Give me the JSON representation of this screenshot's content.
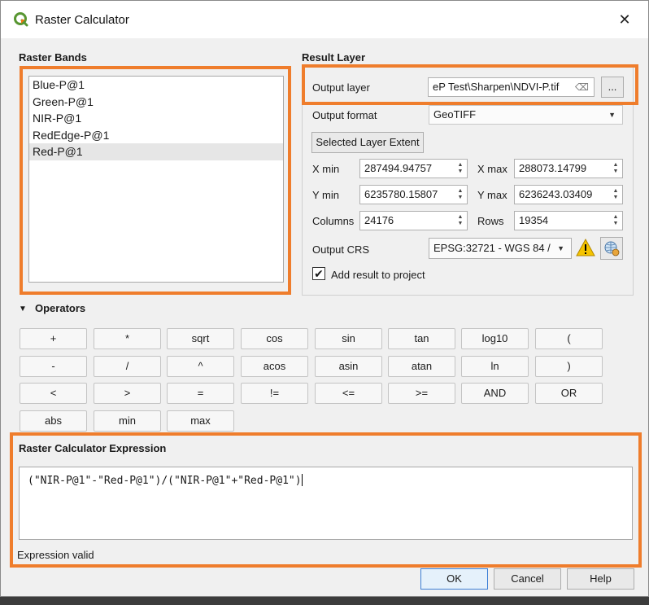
{
  "window": {
    "title": "Raster Calculator",
    "close_glyph": "✕"
  },
  "raster_bands": {
    "title": "Raster Bands",
    "items": [
      "Blue-P@1",
      "Green-P@1",
      "NIR-P@1",
      "RedEdge-P@1",
      "Red-P@1"
    ],
    "selected_index": 4
  },
  "result_layer": {
    "title": "Result Layer",
    "output_layer_label": "Output layer",
    "output_layer_value": "eP Test\\Sharpen\\NDVI-P.tif",
    "browse_label": "...",
    "output_format_label": "Output format",
    "output_format_value": "GeoTIFF",
    "selected_extent_label": "Selected Layer Extent",
    "xmin_label": "X min",
    "xmin_value": "287494.94757",
    "xmax_label": "X max",
    "xmax_value": "288073.14799",
    "ymin_label": "Y min",
    "ymin_value": "6235780.15807",
    "ymax_label": "Y max",
    "ymax_value": "6236243.03409",
    "columns_label": "Columns",
    "columns_value": "24176",
    "rows_label": "Rows",
    "rows_value": "19354",
    "crs_label": "Output CRS",
    "crs_value": "EPSG:32721 - WGS 84 /",
    "add_result_label": "Add result to project",
    "add_result_checked": true
  },
  "operators": {
    "title": "Operators",
    "rows": [
      [
        "+",
        "*",
        "sqrt",
        "cos",
        "sin",
        "tan",
        "log10",
        "("
      ],
      [
        "-",
        "/",
        "^",
        "acos",
        "asin",
        "atan",
        "ln",
        ")"
      ],
      [
        "<",
        ">",
        "=",
        "!=",
        "<=",
        ">=",
        "AND",
        "OR"
      ],
      [
        "abs",
        "min",
        "max"
      ]
    ]
  },
  "expression": {
    "title": "Raster Calculator Expression",
    "value": "(\"NIR-P@1\"-\"Red-P@1\")/(\"NIR-P@1\"+\"Red-P@1\")",
    "status": "Expression valid"
  },
  "buttons": {
    "ok": "OK",
    "cancel": "Cancel",
    "help": "Help"
  },
  "colors": {
    "highlight": "#ef7d2c",
    "qgis_green": "#589632"
  }
}
